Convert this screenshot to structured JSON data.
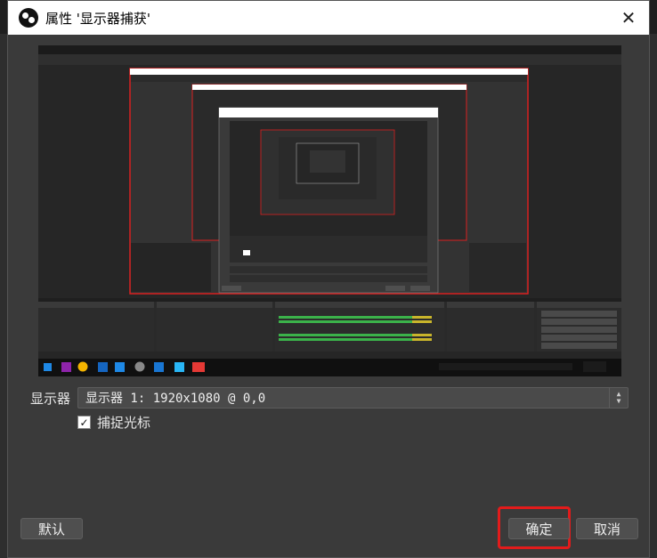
{
  "window": {
    "title": "属性 '显示器捕获'",
    "close_icon": "close-icon"
  },
  "preview": {
    "description_icon": "screen-preview"
  },
  "settings": {
    "display_label": "显示器",
    "display_value": "显示器 1: 1920x1080 @ 0,0",
    "capture_cursor_label": "捕捉光标",
    "capture_cursor_checked": true
  },
  "buttons": {
    "default_label": "默认",
    "ok_label": "确定",
    "cancel_label": "取消"
  },
  "colors": {
    "highlight": "#e21b1b",
    "dialog_bg": "#3a3a3a",
    "titlebar_bg": "#ffffff"
  }
}
